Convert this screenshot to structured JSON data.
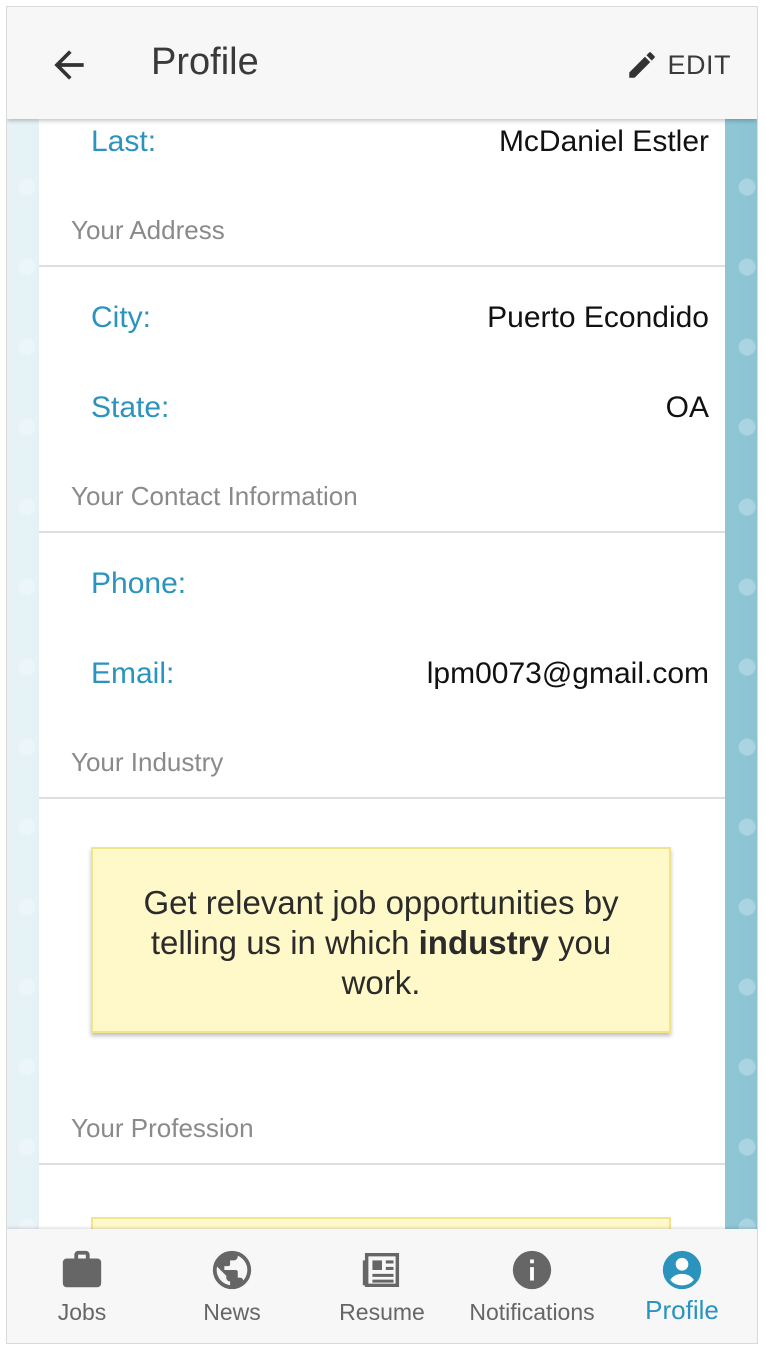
{
  "appbar": {
    "title": "Profile",
    "edit_label": "EDIT"
  },
  "name": {
    "last_label": "Last:",
    "last_value": "McDaniel Estler"
  },
  "address": {
    "header": "Your Address",
    "city_label": "City:",
    "city_value": "Puerto Econdido",
    "state_label": "State:",
    "state_value": "OA"
  },
  "contact": {
    "header": "Your Contact Information",
    "phone_label": "Phone:",
    "phone_value": "",
    "email_label": "Email:",
    "email_value": "lpm0073@gmail.com"
  },
  "industry": {
    "header": "Your Industry",
    "notice_before": "Get relevant job opportunities by telling us in which ",
    "notice_bold": "industry",
    "notice_after": " you work."
  },
  "profession": {
    "header": "Your Profession"
  },
  "bottom_nav": {
    "items": [
      {
        "label": "Jobs",
        "icon": "briefcase-icon"
      },
      {
        "label": "News",
        "icon": "globe-icon"
      },
      {
        "label": "Resume",
        "icon": "newspaper-icon"
      },
      {
        "label": "Notifications",
        "icon": "info-icon"
      },
      {
        "label": "Profile",
        "icon": "account-circle-icon"
      }
    ],
    "active": "Profile"
  },
  "colors": {
    "accent": "#2a93be",
    "notice_bg": "#fff8c8",
    "appbar_bg": "#f7f7f7"
  }
}
